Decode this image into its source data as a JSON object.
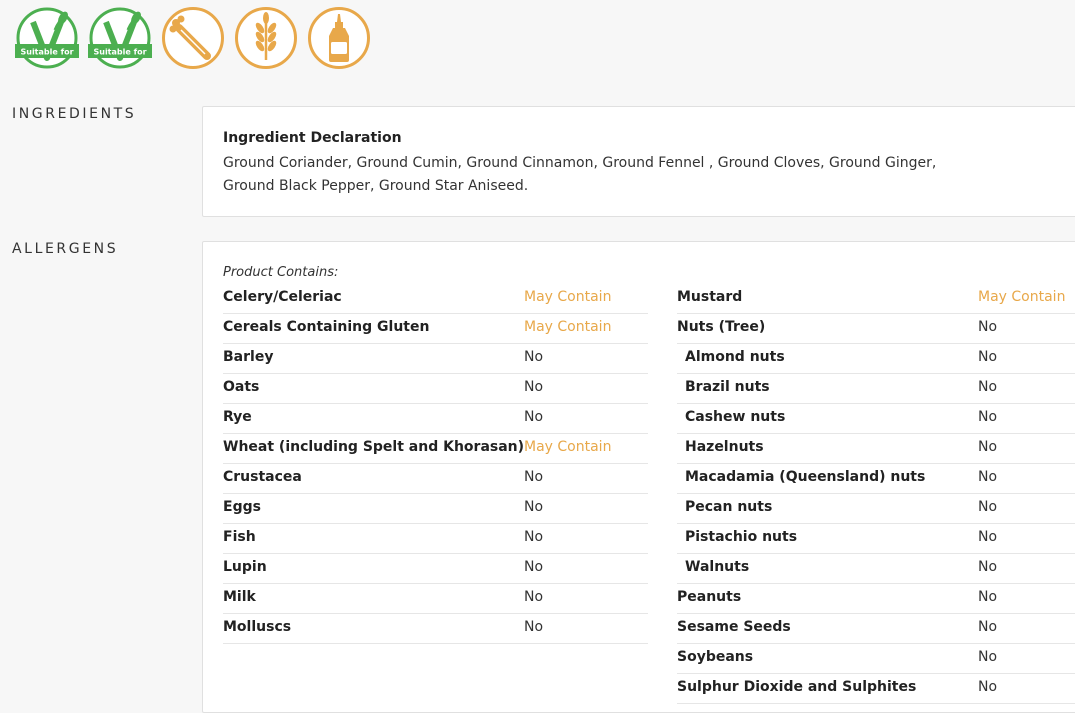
{
  "badges": [
    {
      "name": "vegetarian-badge-icon",
      "label": "Suitable for",
      "color": "#4caf50"
    },
    {
      "name": "vegan-badge-icon",
      "label": "Suitable for",
      "color": "#4caf50"
    },
    {
      "name": "celery-icon",
      "color": "#e8a84a"
    },
    {
      "name": "wheat-icon",
      "color": "#e8a84a"
    },
    {
      "name": "mustard-bottle-icon",
      "color": "#e8a84a"
    }
  ],
  "ingredients": {
    "section_label": "INGREDIENTS",
    "title": "Ingredient Declaration",
    "text": "Ground Coriander, Ground Cumin, Ground Cinnamon, Ground Fennel , Ground Cloves, Ground Ginger, Ground Black Pepper, Ground Star Aniseed."
  },
  "allergens": {
    "section_label": "ALLERGENS",
    "product_contains": "Product Contains:",
    "left": [
      {
        "name": "Celery/Celeriac",
        "value": "May Contain",
        "sub": false
      },
      {
        "name": "Cereals Containing Gluten",
        "value": "May Contain",
        "sub": false
      },
      {
        "name": "Barley",
        "value": "No",
        "sub": false
      },
      {
        "name": "Oats",
        "value": "No",
        "sub": false
      },
      {
        "name": "Rye",
        "value": "No",
        "sub": false
      },
      {
        "name": "Wheat (including Spelt and Khorasan)",
        "value": "May Contain",
        "sub": false
      },
      {
        "name": "Crustacea",
        "value": "No",
        "sub": false
      },
      {
        "name": "Eggs",
        "value": "No",
        "sub": false
      },
      {
        "name": "Fish",
        "value": "No",
        "sub": false
      },
      {
        "name": "Lupin",
        "value": "No",
        "sub": false
      },
      {
        "name": "Milk",
        "value": "No",
        "sub": false
      },
      {
        "name": "Molluscs",
        "value": "No",
        "sub": false
      }
    ],
    "right": [
      {
        "name": "Mustard",
        "value": "May Contain",
        "sub": false
      },
      {
        "name": "Nuts (Tree)",
        "value": "No",
        "sub": false
      },
      {
        "name": "Almond nuts",
        "value": "No",
        "sub": true
      },
      {
        "name": "Brazil nuts",
        "value": "No",
        "sub": true
      },
      {
        "name": "Cashew nuts",
        "value": "No",
        "sub": true
      },
      {
        "name": "Hazelnuts",
        "value": "No",
        "sub": true
      },
      {
        "name": "Macadamia (Queensland) nuts",
        "value": "No",
        "sub": true
      },
      {
        "name": "Pecan nuts",
        "value": "No",
        "sub": true
      },
      {
        "name": "Pistachio nuts",
        "value": "No",
        "sub": true
      },
      {
        "name": "Walnuts",
        "value": "No",
        "sub": true
      },
      {
        "name": "Peanuts",
        "value": "No",
        "sub": false
      },
      {
        "name": "Sesame Seeds",
        "value": "No",
        "sub": false
      },
      {
        "name": "Soybeans",
        "value": "No",
        "sub": false
      },
      {
        "name": "Sulphur Dioxide and Sulphites",
        "value": "No",
        "sub": false
      }
    ]
  }
}
